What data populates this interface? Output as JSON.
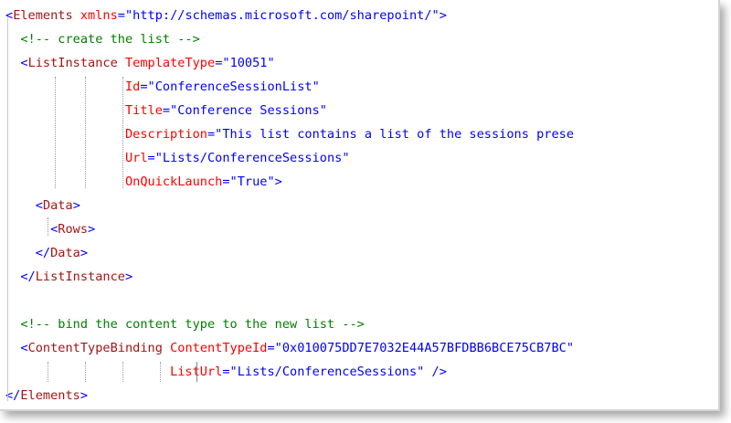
{
  "code": {
    "lines": [
      {
        "parts": [
          [
            "pun",
            "<"
          ],
          [
            "tag",
            "Elements"
          ],
          [
            "plain",
            " "
          ],
          [
            "attr",
            "xmlns"
          ],
          [
            "pun",
            "=\""
          ],
          [
            "str",
            "http://schemas.microsoft.com/sharepoint/"
          ],
          [
            "pun",
            "\">"
          ]
        ]
      },
      {
        "parts": [
          [
            "plain",
            "  "
          ],
          [
            "cmt",
            "<!-- create the list -->"
          ]
        ]
      },
      {
        "parts": [
          [
            "plain",
            "  "
          ],
          [
            "pun",
            "<"
          ],
          [
            "tag",
            "ListInstance"
          ],
          [
            "plain",
            " "
          ],
          [
            "attr",
            "TemplateType"
          ],
          [
            "pun",
            "=\""
          ],
          [
            "str",
            "10051"
          ],
          [
            "pun",
            "\""
          ]
        ]
      },
      {
        "parts": [
          [
            "plain",
            "                "
          ],
          [
            "attr",
            "Id"
          ],
          [
            "pun",
            "=\""
          ],
          [
            "str",
            "ConferenceSessionList"
          ],
          [
            "pun",
            "\""
          ]
        ]
      },
      {
        "parts": [
          [
            "plain",
            "                "
          ],
          [
            "attr",
            "Title"
          ],
          [
            "pun",
            "=\""
          ],
          [
            "str",
            "Conference Sessions"
          ],
          [
            "pun",
            "\""
          ]
        ]
      },
      {
        "parts": [
          [
            "plain",
            "                "
          ],
          [
            "attr",
            "Description"
          ],
          [
            "pun",
            "=\""
          ],
          [
            "str",
            "This list contains a list of the sessions prese"
          ]
        ]
      },
      {
        "parts": [
          [
            "plain",
            "                "
          ],
          [
            "attr",
            "Url"
          ],
          [
            "pun",
            "=\""
          ],
          [
            "str",
            "Lists/ConferenceSessions"
          ],
          [
            "pun",
            "\""
          ]
        ]
      },
      {
        "parts": [
          [
            "plain",
            "                "
          ],
          [
            "attr",
            "OnQuickLaunch"
          ],
          [
            "pun",
            "=\""
          ],
          [
            "str",
            "True"
          ],
          [
            "pun",
            "\">"
          ]
        ]
      },
      {
        "parts": [
          [
            "plain",
            "    "
          ],
          [
            "pun",
            "<"
          ],
          [
            "tag",
            "Data"
          ],
          [
            "pun",
            ">"
          ]
        ]
      },
      {
        "parts": [
          [
            "plain",
            "      "
          ],
          [
            "pun",
            "<"
          ],
          [
            "tag",
            "Rows"
          ],
          [
            "pun",
            ">"
          ]
        ]
      },
      {
        "parts": [
          [
            "plain",
            "    "
          ],
          [
            "pun",
            "</"
          ],
          [
            "tag",
            "Data"
          ],
          [
            "pun",
            ">"
          ]
        ]
      },
      {
        "parts": [
          [
            "plain",
            "  "
          ],
          [
            "pun",
            "</"
          ],
          [
            "tag",
            "ListInstance"
          ],
          [
            "pun",
            ">"
          ]
        ]
      },
      {
        "parts": []
      },
      {
        "parts": [
          [
            "plain",
            "  "
          ],
          [
            "cmt",
            "<!-- bind the content type to the new list -->"
          ]
        ]
      },
      {
        "parts": [
          [
            "plain",
            "  "
          ],
          [
            "pun",
            "<"
          ],
          [
            "tag",
            "ContentTypeBinding"
          ],
          [
            "plain",
            " "
          ],
          [
            "attr",
            "ContentTypeId"
          ],
          [
            "pun",
            "=\""
          ],
          [
            "str",
            "0x010075DD7E7032E44A57BFDBB6BCE75CB7BC"
          ],
          [
            "pun",
            "\""
          ]
        ]
      },
      {
        "parts": [
          [
            "plain",
            "                      "
          ],
          [
            "attr",
            "ListUrl"
          ],
          [
            "pun",
            "=\""
          ],
          [
            "str",
            "Lists/ConferenceSessions"
          ],
          [
            "pun",
            "\" />"
          ]
        ]
      },
      {
        "parts": [
          [
            "pun",
            "</"
          ],
          [
            "tag",
            "Elements"
          ],
          [
            "pun",
            ">"
          ]
        ]
      }
    ]
  }
}
